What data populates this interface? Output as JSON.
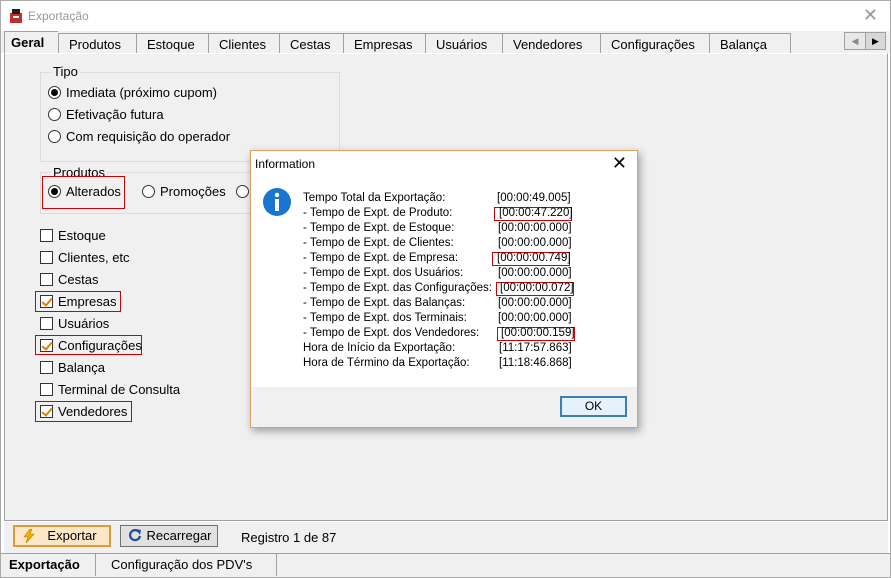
{
  "window": {
    "title": "Exportação"
  },
  "tabs": [
    "Geral",
    "Produtos",
    "Estoque",
    "Clientes",
    "Cestas",
    "Empresas",
    "Usuários",
    "Vendedores",
    "Configurações",
    "Balança"
  ],
  "tipo": {
    "label": "Tipo",
    "options": [
      "Imediata (próximo cupom)",
      "Efetivação futura",
      "Com requisição do operador"
    ],
    "selected": 0
  },
  "produtos": {
    "label": "Produtos",
    "options": [
      "Alterados",
      "Promoções"
    ],
    "selected": 0
  },
  "checks": [
    {
      "label": "Estoque",
      "checked": false
    },
    {
      "label": "Clientes, etc",
      "checked": false
    },
    {
      "label": "Cestas",
      "checked": false
    },
    {
      "label": "Empresas",
      "checked": true
    },
    {
      "label": "Usuários",
      "checked": false
    },
    {
      "label": "Configurações",
      "checked": true
    },
    {
      "label": "Balança",
      "checked": false
    },
    {
      "label": "Terminal de Consulta",
      "checked": false
    },
    {
      "label": "Vendedores",
      "checked": true
    }
  ],
  "toolbar": {
    "export_label": "Exportar",
    "reload_label": "Recarregar",
    "record_text": "Registro 1 de 87"
  },
  "bottom_tabs": [
    "Exportação",
    "Configuração dos PDV's"
  ],
  "dialog": {
    "title": "Information",
    "ok_label": "OK",
    "lines": [
      {
        "label": "Tempo Total da Exportação:",
        "value": "[00:00:49.005]",
        "boxed": false
      },
      {
        "label": "- Tempo de Expt. de Produto:",
        "value": "[00:00:47.220]",
        "boxed": true
      },
      {
        "label": "- Tempo de Expt. de Estoque:",
        "value": "[00:00:00.000]",
        "boxed": false
      },
      {
        "label": "- Tempo de Expt. de Clientes:",
        "value": "[00:00:00.000]",
        "boxed": false
      },
      {
        "label": "- Tempo de Expt. de Empresa:",
        "value": "[00:00:00.749]",
        "boxed": true
      },
      {
        "label": "- Tempo de Expt. dos Usuários:",
        "value": "[00:00:00.000]",
        "boxed": false
      },
      {
        "label": "- Tempo de Expt. das Configurações:",
        "value": "[00:00:00.072]",
        "boxed": true
      },
      {
        "label": "- Tempo de Expt. das Balanças:",
        "value": "[00:00:00.000]",
        "boxed": false
      },
      {
        "label": "- Tempo de Expt. dos Terminais:",
        "value": "[00:00:00.000]",
        "boxed": false
      },
      {
        "label": "- Tempo de Expt. dos Vendedores:",
        "value": "[00:00:00.159]",
        "boxed": true
      },
      {
        "label": "Hora de Início da Exportação:",
        "value": "[11:17:57.863]",
        "boxed": false
      },
      {
        "label": "Hora de Término da Exportação:",
        "value": "[11:18:46.868]",
        "boxed": false
      }
    ]
  },
  "colors": {
    "highlight": "#d00000",
    "check_mark": "#e08000",
    "info_blue": "#1a75d2",
    "export_button": "#fbe6c8"
  },
  "icons": {
    "app": "app-icon",
    "export": "lightning-icon",
    "reload": "reload-icon",
    "info": "info-icon"
  }
}
